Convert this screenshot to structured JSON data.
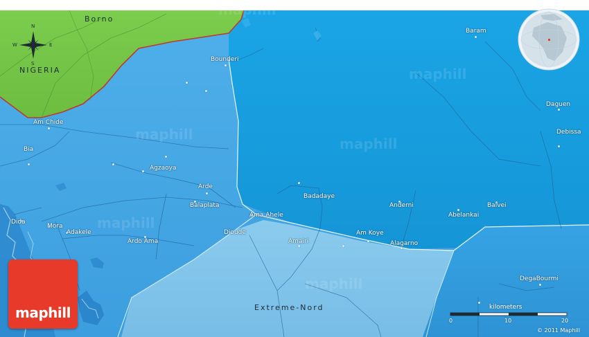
{
  "map": {
    "colors": {
      "lake": "#19a3e4",
      "water_light": "#7ec5ea",
      "region_mid": "#3aa8e6",
      "nigeria_land": "#78c74a",
      "border": "#c0392b",
      "logo": "#e83a2a"
    },
    "regions": {
      "borno": "Borno",
      "nigeria": "NIGERIA",
      "extreme_nord": "Extreme-Nord"
    },
    "compass": {
      "n": "N",
      "s": "S",
      "e": "E",
      "w": "W"
    },
    "places": [
      {
        "id": "bounderi",
        "name": "Bounderi"
      },
      {
        "id": "baram",
        "name": "Baram"
      },
      {
        "id": "daguen",
        "name": "Daguen"
      },
      {
        "id": "debissa",
        "name": "Debissa"
      },
      {
        "id": "am-chide",
        "name": "Am Chide"
      },
      {
        "id": "bia",
        "name": "Bia"
      },
      {
        "id": "agzaoya",
        "name": "Agzaoya"
      },
      {
        "id": "arde",
        "name": "Arde"
      },
      {
        "id": "balaplata",
        "name": "Balaplata"
      },
      {
        "id": "badadaye",
        "name": "Badadaye"
      },
      {
        "id": "anderni",
        "name": "Anderni"
      },
      {
        "id": "abelankai",
        "name": "Abelankai"
      },
      {
        "id": "balvei",
        "name": "Balvei"
      },
      {
        "id": "ama-ahele",
        "name": "Ama Ahele"
      },
      {
        "id": "dida",
        "name": "Dida"
      },
      {
        "id": "mora",
        "name": "Mora"
      },
      {
        "id": "adakele",
        "name": "Adakele"
      },
      {
        "id": "dioude",
        "name": "Dioude"
      },
      {
        "id": "ardo-ama",
        "name": "Ardo Ama"
      },
      {
        "id": "amairi",
        "name": "Amairi"
      },
      {
        "id": "am-koye",
        "name": "Am Koye"
      },
      {
        "id": "alagarno",
        "name": "Alagarno"
      },
      {
        "id": "degabourmi",
        "name": "DegaBourmi"
      }
    ],
    "scale": {
      "title": "kilometers",
      "ticks": [
        "0",
        "10",
        "20"
      ]
    },
    "copyright": "© 2011 Maphill",
    "logo_text": "maphill",
    "watermark": "maphill"
  }
}
